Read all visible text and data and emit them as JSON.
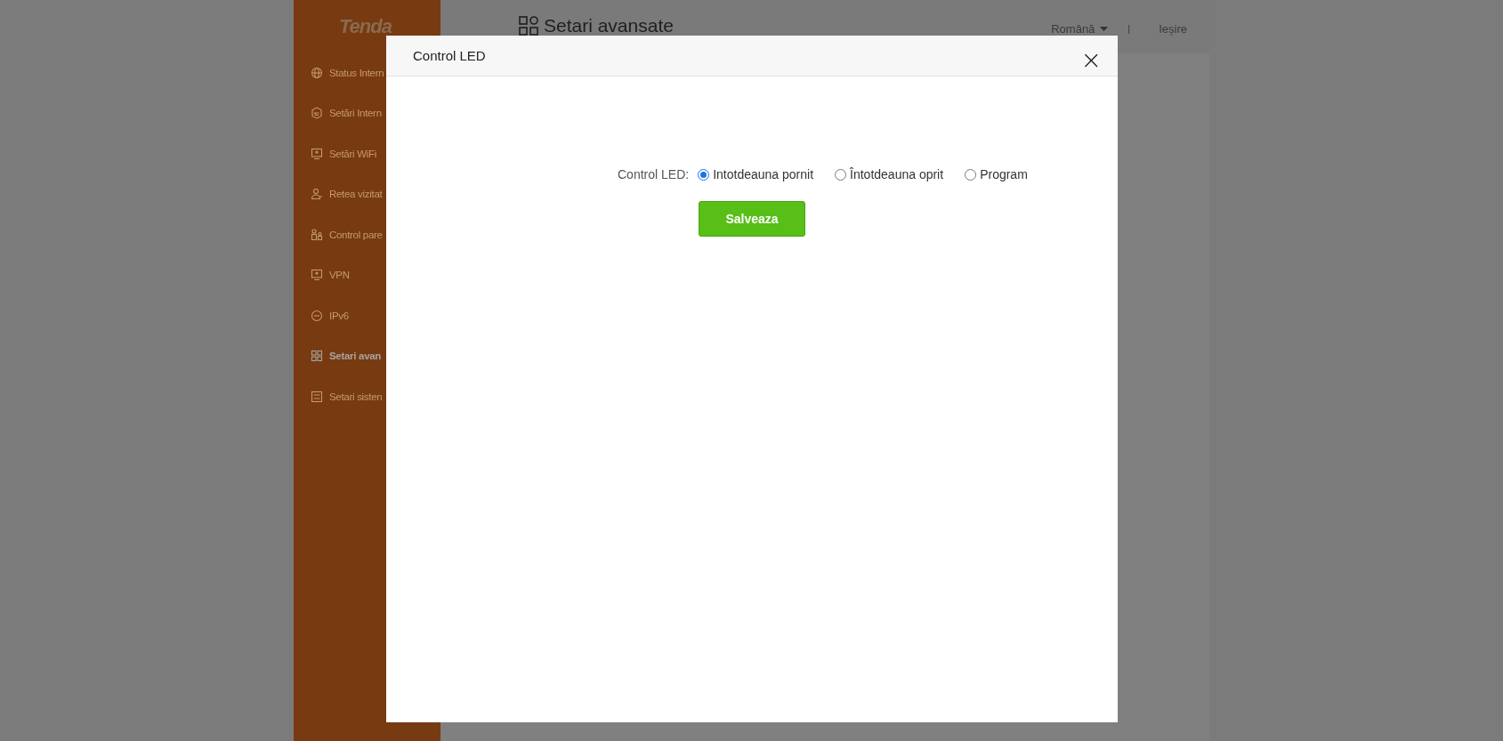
{
  "sidebar": {
    "logo": "Tenda",
    "items": [
      {
        "label": "Status Intern",
        "selected": false
      },
      {
        "label": "Setări Intern",
        "selected": false
      },
      {
        "label": "Setări WiFi",
        "selected": false
      },
      {
        "label": "Retea vizitat",
        "selected": false
      },
      {
        "label": "Control pare",
        "selected": false
      },
      {
        "label": "VPN",
        "selected": false
      },
      {
        "label": "IPv6",
        "selected": false
      },
      {
        "label": "Setari avan",
        "selected": true
      },
      {
        "label": "Setari sisten",
        "selected": false
      }
    ]
  },
  "header": {
    "title": "Setari avansate",
    "language": "Română",
    "separator": "|",
    "logout": "Ieșire"
  },
  "modal": {
    "title": "Control LED",
    "close": "×",
    "field_label": "Control LED:",
    "options": [
      {
        "label": "Intotdeauna pornit",
        "selected": true
      },
      {
        "label": "Întotdeauna oprit",
        "selected": false
      },
      {
        "label": "Program",
        "selected": false
      }
    ],
    "save_button": "Salveaza"
  }
}
